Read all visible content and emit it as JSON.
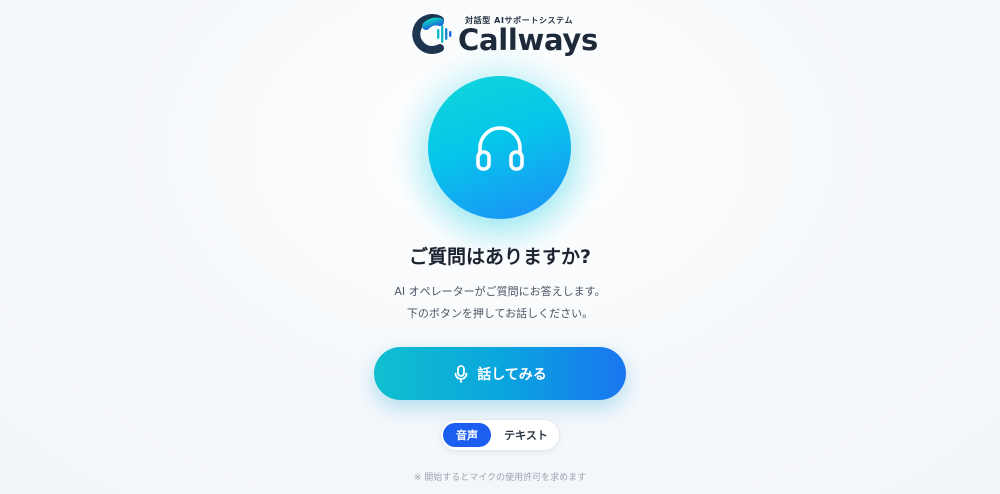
{
  "brand": {
    "tagline": "対話型 AIサポートシステム",
    "name": "Callways",
    "colors": {
      "primary": "#1b5ef0",
      "teal": "#12d6d8",
      "dark": "#1e2a3a"
    }
  },
  "hero": {
    "icon": "headset-icon",
    "title": "ご質問はありますか?",
    "description_line1": "AI オペレーターがご質問にお答えします。",
    "description_line2": "下のボタンを押してお話しください。"
  },
  "talk_button": {
    "icon": "microphone-icon",
    "label": "話してみる"
  },
  "mode_toggle": {
    "options": [
      "音声",
      "テキスト"
    ],
    "selected": "音声"
  },
  "notice": "※ 開始するとマイクの使用許可を求めます"
}
